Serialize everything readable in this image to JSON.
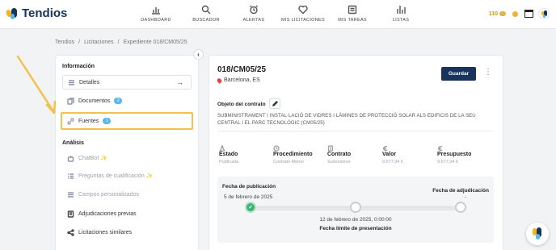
{
  "app": {
    "name": "Tendios"
  },
  "nav": [
    {
      "label": "DASHBOARD",
      "icon": "bar-chart-icon"
    },
    {
      "label": "BUSCADOR",
      "icon": "search-icon"
    },
    {
      "label": "ALERTAS",
      "icon": "alarm-clock-icon"
    },
    {
      "label": "MIS LICITACIONES",
      "icon": "heart-icon"
    },
    {
      "label": "MIS TAREAS",
      "icon": "tasks-icon"
    },
    {
      "label": "LISTAS",
      "icon": "list-chart-icon"
    }
  ],
  "header": {
    "credits": "110"
  },
  "breadcrumb": [
    "Tendios",
    "/",
    "Licitaciones",
    "/",
    "Expediente 018/CM05/25"
  ],
  "sidebar": {
    "info_title": "Información",
    "analysis_title": "Análisis",
    "info_items": [
      {
        "label": "Detalles"
      },
      {
        "label": "Documentos",
        "badge": "2"
      },
      {
        "label": "Fuentes",
        "badge": "1"
      }
    ],
    "analysis_items": [
      {
        "label": "ChatBot"
      },
      {
        "label": "Preguntas de cualificación"
      },
      {
        "label": "Campos personalizados"
      },
      {
        "label": "Adjudicaciones previas"
      },
      {
        "label": "Licitaciones similares"
      }
    ]
  },
  "main": {
    "title": "018/CM05/25",
    "location": "Barcelona, ES",
    "save_label": "Guardar",
    "object_label": "Objeto del contrato",
    "object_text": "SUBMINISTRAMENT I INSTAL·LACIÓ DE VIDRES I LÀMINES DE PROTECCIÓ SOLAR ALS EDIFICIS DE LA SEU CENTRAL I EL PARC TECNOLÒGIC (CM05/25)",
    "meta": [
      {
        "label": "Estado",
        "value": "Publicada"
      },
      {
        "label": "Procedimiento",
        "value": "Contrato Menor"
      },
      {
        "label": "Contrato",
        "value": "Suministros"
      },
      {
        "label": "Valor",
        "value": "9.677,94 €"
      },
      {
        "label": "Presupuesto",
        "value": "9.677,94 €"
      }
    ],
    "timeline": {
      "pub_label": "Fecha de publicación",
      "pub_date": "5 de febrero de 2025",
      "adj_label": "Fecha de adjudicación",
      "adj_date": "-",
      "deadline_date": "12 de febrero de 2025, 0:00:00",
      "deadline_label": "Fecha límite de presentación"
    }
  }
}
